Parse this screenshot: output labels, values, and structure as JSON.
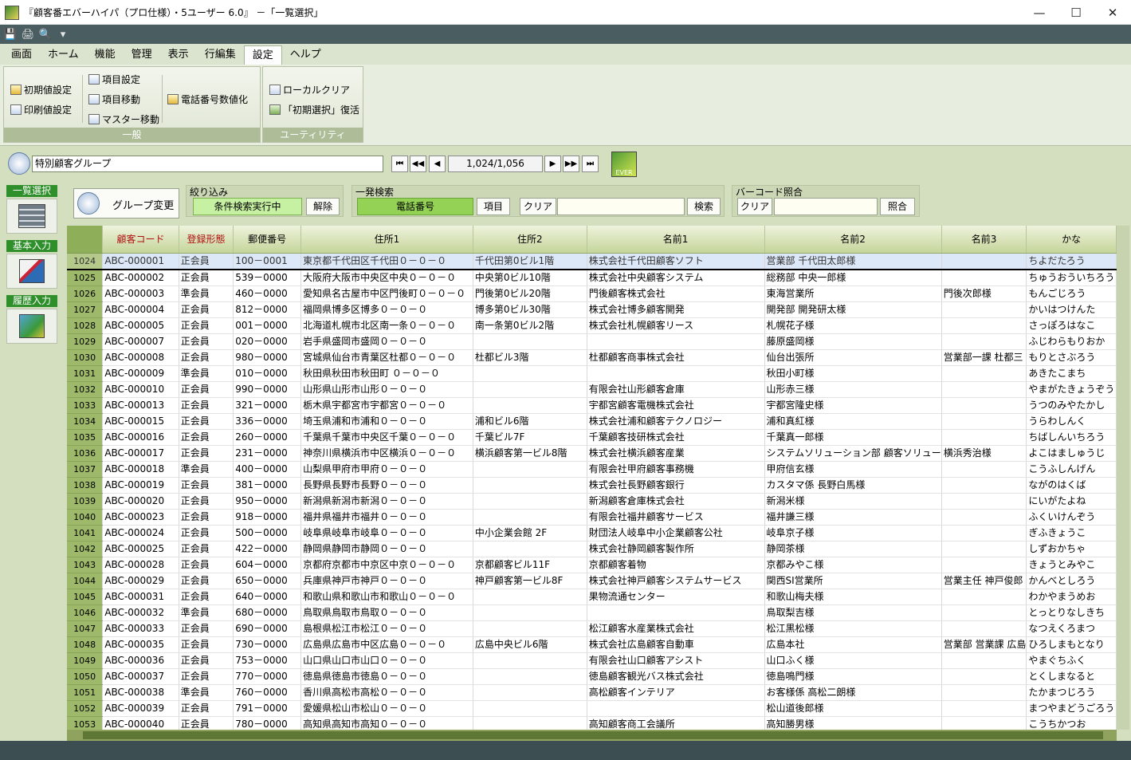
{
  "window": {
    "title": "『顧客番エバーハイパ（プロ仕様）・5ユーザー 6.0』 －「一覧選択」",
    "minimize": "—",
    "maximize": "☐",
    "close": "✕"
  },
  "qat": [
    "💾",
    "🖨",
    "🔍",
    "▾"
  ],
  "menu": [
    "画面",
    "ホーム",
    "機能",
    "管理",
    "表示",
    "行編集",
    "設定",
    "ヘルプ"
  ],
  "ribbon": {
    "general": {
      "label": "一般",
      "initial": "初期値設定",
      "print": "印刷値設定",
      "item_setting": "項目設定",
      "item_move": "項目移動",
      "master_move": "マスター移動",
      "phone_numeric": "電話番号数値化"
    },
    "utility": {
      "label": "ユーティリティ",
      "local_clear": "ローカルクリア",
      "restore": "「初期選択」復活"
    }
  },
  "nav": {
    "group_name": "特別顧客グループ",
    "counter": "1,024/1,056",
    "first": "⏮",
    "prev_page": "◀◀",
    "prev": "◀",
    "next": "▶",
    "next_page": "▶▶",
    "last": "⏭",
    "ever": "EVER"
  },
  "sidebar": {
    "list": "一覧選択",
    "basic": "基本入力",
    "history": "履歴入力"
  },
  "controls": {
    "group_change": "グループ変更",
    "filter": {
      "title": "絞り込み",
      "status": "条件検索実行中",
      "release": "解除"
    },
    "search": {
      "title": "一発検索",
      "field": "電話番号",
      "item": "項目",
      "clear": "クリア",
      "go": "検索"
    },
    "barcode": {
      "title": "バーコード照合",
      "clear": "クリア",
      "match": "照合"
    }
  },
  "table": {
    "headers": [
      "",
      "顧客コード",
      "登録形態",
      "郵便番号",
      "住所1",
      "住所2",
      "名前1",
      "名前2",
      "名前3",
      "かな"
    ],
    "rows": [
      [
        "1024",
        "ABC-000001",
        "正会員",
        "100－0001",
        "東京都千代田区千代田０－０－０",
        "千代田第0ビル1階",
        "株式会社千代田顧客ソフト",
        "営業部 千代田太郎様",
        "",
        "ちよだたろう"
      ],
      [
        "1025",
        "ABC-000002",
        "正会員",
        "539－0000",
        "大阪府大阪市中央区中央０－０－０",
        "中央第0ビル10階",
        "株式会社中央顧客システム",
        "総務部 中央一郎様",
        "",
        "ちゅうおういちろう"
      ],
      [
        "1026",
        "ABC-000003",
        "準会員",
        "460－0000",
        "愛知県名古屋市中区門後町０－０－０",
        "門後第0ビル20階",
        "門後顧客株式会社",
        "東海営業所",
        "門後次郎様",
        "もんごじろう"
      ],
      [
        "1027",
        "ABC-000004",
        "正会員",
        "812－0000",
        "福岡県博多区博多０－０－０",
        "博多第0ビル30階",
        "株式会社博多顧客開発",
        "開発部 開発研太様",
        "",
        "かいはつけんた"
      ],
      [
        "1028",
        "ABC-000005",
        "正会員",
        "001－0000",
        "北海道札幌市北区南一条０－０－０",
        "南一条第0ビル2階",
        "株式会社札幌顧客リース",
        "札幌花子様",
        "",
        "さっぽろはなこ"
      ],
      [
        "1029",
        "ABC-000007",
        "正会員",
        "020－0000",
        "岩手県盛岡市盛岡０－０－０",
        "",
        "",
        "藤原盛岡様",
        "",
        "ふじわらもりおか"
      ],
      [
        "1030",
        "ABC-000008",
        "正会員",
        "980－0000",
        "宮城県仙台市青葉区杜都０－０－０",
        "杜都ビル3階",
        "杜都顧客商事株式会社",
        "仙台出張所",
        "営業部一課 杜都三",
        "もりとさぶろう"
      ],
      [
        "1031",
        "ABC-000009",
        "準会員",
        "010－0000",
        "秋田県秋田市秋田町 ０－０－０",
        "",
        "",
        "秋田小町様",
        "",
        "あきたこまち"
      ],
      [
        "1032",
        "ABC-000010",
        "正会員",
        "990－0000",
        "山形県山形市山形０－０－０",
        "",
        "有限会社山形顧客倉庫",
        "山形赤三様",
        "",
        "やまがたきょうぞう"
      ],
      [
        "1033",
        "ABC-000013",
        "正会員",
        "321－0000",
        "栃木県宇都宮市宇都宮０－０－０",
        "",
        "宇都宮顧客電機株式会社",
        "宇都宮隆史様",
        "",
        "うつのみやたかし"
      ],
      [
        "1034",
        "ABC-000015",
        "正会員",
        "336－0000",
        "埼玉県浦和市浦和０－０－０",
        "浦和ビル6階",
        "株式会社浦和顧客テクノロジー",
        "浦和真紅様",
        "",
        "うらわしんく"
      ],
      [
        "1035",
        "ABC-000016",
        "正会員",
        "260－0000",
        "千葉県千葉市中央区千葉０－０－０",
        "千葉ビル7F",
        "千葉顧客技研株式会社",
        "千葉真一郎様",
        "",
        "ちばしんいちろう"
      ],
      [
        "1036",
        "ABC-000017",
        "正会員",
        "231－0000",
        "神奈川県横浜市中区横浜０－０－０",
        "横浜顧客第一ビル8階",
        "株式会社横浜顧客産業",
        "システムソリューション部 顧客ソリュー",
        "横浜秀治様",
        "よこはましゅうじ"
      ],
      [
        "1037",
        "ABC-000018",
        "準会員",
        "400－0000",
        "山梨県甲府市甲府０－０－０",
        "",
        "有限会社甲府顧客事務機",
        "甲府信玄様",
        "",
        "こうふしんげん"
      ],
      [
        "1038",
        "ABC-000019",
        "正会員",
        "381－0000",
        "長野県長野市長野０－０－０",
        "",
        "株式会社長野顧客銀行",
        "カスタマ係 長野白馬様",
        "",
        "ながのはくば"
      ],
      [
        "1039",
        "ABC-000020",
        "正会員",
        "950－0000",
        "新潟県新潟市新潟０－０－０",
        "",
        "新潟顧客倉庫株式会社",
        "新潟米様",
        "",
        "にいがたよね"
      ],
      [
        "1040",
        "ABC-000023",
        "正会員",
        "918－0000",
        "福井県福井市福井０－０－０",
        "",
        "有限会社福井顧客サービス",
        "福井謙三様",
        "",
        "ふくいけんぞう"
      ],
      [
        "1041",
        "ABC-000024",
        "正会員",
        "500－0000",
        "岐阜県岐阜市岐阜０－０－０",
        "中小企業会館 2F",
        "財団法人岐阜中小企業顧客公社",
        "岐阜京子様",
        "",
        "ぎふきょうこ"
      ],
      [
        "1042",
        "ABC-000025",
        "正会員",
        "422－0000",
        "静岡県静岡市静岡０－０－０",
        "",
        "株式会社静岡顧客製作所",
        "静岡茶様",
        "",
        "しずおかちゃ"
      ],
      [
        "1043",
        "ABC-000028",
        "正会員",
        "604－0000",
        "京都府京都市中京区中京０－０－０",
        "京都顧客ビル11F",
        "京都顧客着物",
        "京都みやこ様",
        "",
        "きょうとみやこ"
      ],
      [
        "1044",
        "ABC-000029",
        "正会員",
        "650－0000",
        "兵庫県神戸市神戸０－０－０",
        "神戸顧客第一ビル8F",
        "株式会社神戸顧客システムサービス",
        "関西SI営業所",
        "営業主任 神戸俊郎",
        "かんべとしろう"
      ],
      [
        "1045",
        "ABC-000031",
        "正会員",
        "640－0000",
        "和歌山県和歌山市和歌山０－０－０",
        "",
        "果物流通センター",
        "和歌山梅夫様",
        "",
        "わかやまうめお"
      ],
      [
        "1046",
        "ABC-000032",
        "準会員",
        "680－0000",
        "鳥取県鳥取市鳥取０－０－０",
        "",
        "",
        "鳥取梨吉様",
        "",
        "とっとりなしきち"
      ],
      [
        "1047",
        "ABC-000033",
        "正会員",
        "690－0000",
        "島根県松江市松江０－０－０",
        "",
        "松江顧客水産業株式会社",
        "松江黒松様",
        "",
        "なつえくろまつ"
      ],
      [
        "1048",
        "ABC-000035",
        "正会員",
        "730－0000",
        "広島県広島市中区広島０－０－０",
        "広島中央ビル6階",
        "株式会社広島顧客自動車",
        "広島本社",
        "営業部 営業課 広島",
        "ひろしまもとなり"
      ],
      [
        "1049",
        "ABC-000036",
        "正会員",
        "753－0000",
        "山口県山口市山口０－０－０",
        "",
        "有限会社山口顧客アシスト",
        "山口ふく様",
        "",
        "やまぐちふく"
      ],
      [
        "1050",
        "ABC-000037",
        "正会員",
        "770－0000",
        "徳島県徳島市徳島０－０－０",
        "",
        "徳島顧客観光バス株式会社",
        "徳島鳴門様",
        "",
        "とくしまなると"
      ],
      [
        "1051",
        "ABC-000038",
        "準会員",
        "760－0000",
        "香川県高松市高松０－０－０",
        "",
        "高松顧客インテリア",
        "お客様係 高松二朗様",
        "",
        "たかまつじろう"
      ],
      [
        "1052",
        "ABC-000039",
        "正会員",
        "791－0000",
        "愛媛県松山市松山０－０－０",
        "",
        "",
        "松山道後郎様",
        "",
        "まつやまどうごろう"
      ],
      [
        "1053",
        "ABC-000040",
        "正会員",
        "780－0000",
        "高知県高知市高知０－０－０",
        "",
        "高知顧客商工会議所",
        "高知勝男様",
        "",
        "こうちかつお"
      ]
    ]
  },
  "colors": {
    "accent_green": "#2f8f2a",
    "header_red": "#b01010",
    "status_bar": "#3c4e52"
  }
}
